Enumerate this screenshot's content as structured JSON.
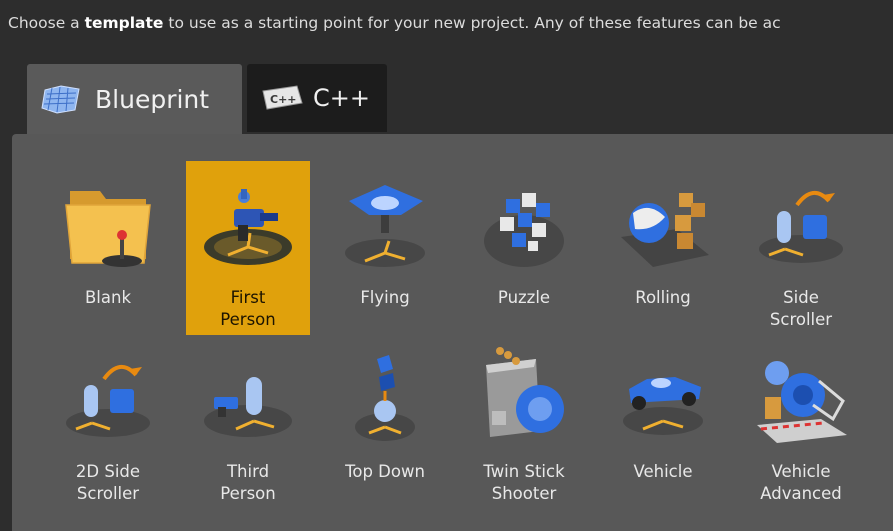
{
  "instruction": {
    "before": "Choose a ",
    "bold": "template",
    "after": " to use as a starting point for your new project.  Any of these features can be ac"
  },
  "tabs": [
    {
      "label": "Blueprint",
      "icon": "blueprint-icon",
      "active": true
    },
    {
      "label": "C++",
      "icon": "cpp-icon",
      "active": false
    }
  ],
  "templates": [
    {
      "label": "Blank",
      "icon": "folder-joystick-icon"
    },
    {
      "label": "First\nPerson",
      "icon": "first-person-gun-icon",
      "selected": true
    },
    {
      "label": "Flying",
      "icon": "spaceship-icon"
    },
    {
      "label": "Puzzle",
      "icon": "puzzle-blocks-icon"
    },
    {
      "label": "Rolling",
      "icon": "rolling-ball-icon"
    },
    {
      "label": "Side\nScroller",
      "icon": "side-scroller-icon"
    },
    {
      "label": "2D Side\nScroller",
      "icon": "2d-side-scroller-icon"
    },
    {
      "label": "Third\nPerson",
      "icon": "third-person-icon"
    },
    {
      "label": "Top Down",
      "icon": "top-down-icon"
    },
    {
      "label": "Twin Stick\nShooter",
      "icon": "twin-stick-shooter-icon"
    },
    {
      "label": "Vehicle",
      "icon": "vehicle-car-icon"
    },
    {
      "label": "Vehicle\nAdvanced",
      "icon": "vehicle-advanced-icon"
    }
  ],
  "colors": {
    "selected": "#e0a10c",
    "panel": "#585858",
    "accent_blue": "#2f6fe0"
  }
}
